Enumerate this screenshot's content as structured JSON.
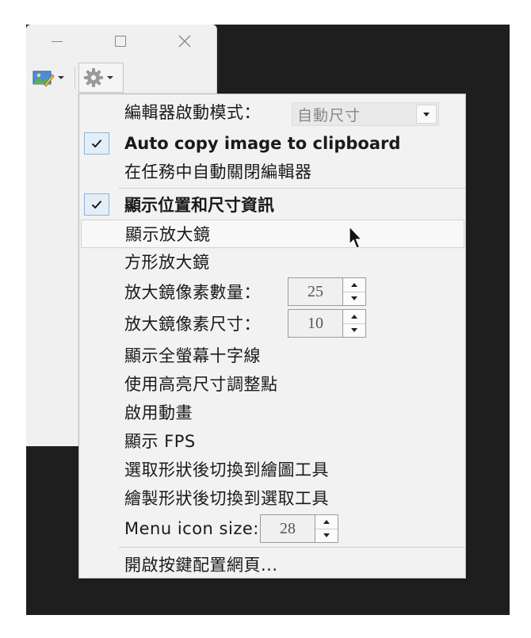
{
  "window": {
    "minimize_icon": "minimize-icon",
    "maximize_icon": "maximize-icon",
    "close_icon": "close-icon"
  },
  "toolbar": {
    "image_tool_icon": "image-pencil-icon",
    "settings_icon": "gear-icon"
  },
  "menu": {
    "editor_mode": {
      "label": "編輯器啟動模式：",
      "value": "自動尺寸"
    },
    "auto_copy": {
      "label": "Auto copy image to clipboard",
      "checked": true
    },
    "auto_close": {
      "label": "在任務中自動關閉編輯器"
    },
    "show_info": {
      "label": "顯示位置和尺寸資訊",
      "checked": true
    },
    "show_magnifier": {
      "label": "顯示放大鏡"
    },
    "square_magnifier": {
      "label": "方形放大鏡"
    },
    "magnifier_pixel_count": {
      "label": "放大鏡像素數量：",
      "value": "25"
    },
    "magnifier_pixel_size": {
      "label": "放大鏡像素尺寸：",
      "value": "10"
    },
    "crosshair": {
      "label": "顯示全螢幕十字線"
    },
    "resize_handles": {
      "label": "使用高亮尺寸調整點"
    },
    "animations": {
      "label": "啟用動畫"
    },
    "show_fps": {
      "label": "顯示 FPS"
    },
    "switch_to_draw": {
      "label": "選取形狀後切換到繪圖工具"
    },
    "switch_to_select": {
      "label": "繪製形狀後切換到選取工具"
    },
    "menu_icon_size": {
      "label": "Menu icon size:",
      "value": "28"
    },
    "hotkeys_page": {
      "label": "開啟按鍵配置網頁..."
    }
  },
  "colors": {
    "menu_bg": "#f2f2f2",
    "check_bg": "#e3eef9",
    "check_border": "#8fb3d6",
    "backdrop": "#1e1e1e"
  }
}
